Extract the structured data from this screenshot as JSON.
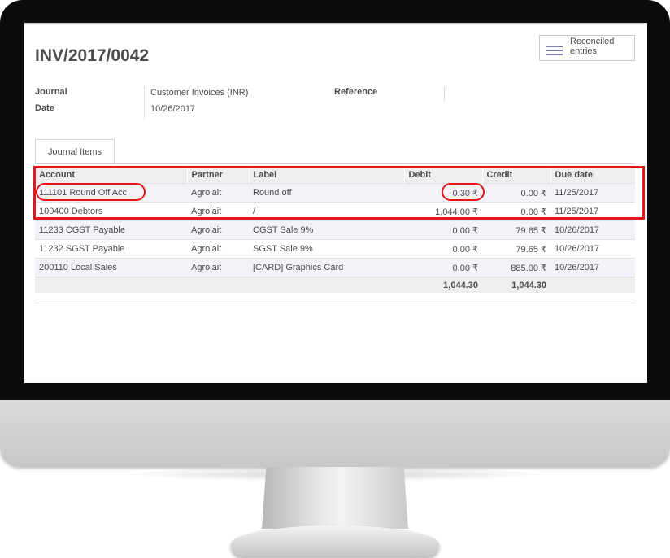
{
  "document": {
    "title": "INV/2017/0042",
    "reconciled_button": "Reconciled entries",
    "fields": {
      "journal_label": "Journal",
      "journal_value": "Customer Invoices (INR)",
      "date_label": "Date",
      "date_value": "10/26/2017",
      "reference_label": "Reference"
    }
  },
  "tabs": [
    {
      "label": "Journal Items"
    }
  ],
  "table": {
    "headers": [
      "Account",
      "Partner",
      "Label",
      "Debit",
      "Credit",
      "Due date"
    ],
    "rows": [
      {
        "account": "111101 Round Off Acc",
        "partner": "Agrolait",
        "label": "Round off",
        "debit": "0.30 ₹",
        "credit": "0.00 ₹",
        "due": "11/25/2017"
      },
      {
        "account": "100400 Debtors",
        "partner": "Agrolait",
        "label": "/",
        "debit": "1,044.00 ₹",
        "credit": "0.00 ₹",
        "due": "11/25/2017"
      },
      {
        "account": "11233 CGST Payable",
        "partner": "Agrolait",
        "label": "CGST Sale 9%",
        "debit": "0.00 ₹",
        "credit": "79.65 ₹",
        "due": "10/26/2017"
      },
      {
        "account": "11232 SGST Payable",
        "partner": "Agrolait",
        "label": "SGST Sale 9%",
        "debit": "0.00 ₹",
        "credit": "79.65 ₹",
        "due": "10/26/2017"
      },
      {
        "account": "200110 Local Sales",
        "partner": "Agrolait",
        "label": "[CARD] Graphics Card",
        "debit": "0.00 ₹",
        "credit": "885.00 ₹",
        "due": "10/26/2017"
      }
    ],
    "totals": {
      "debit": "1,044.30",
      "credit": "1,044.30"
    }
  },
  "colors": {
    "highlight": "#e8141b",
    "menu_icon": "#7c7bad",
    "text": "#4c4c4c"
  },
  "icons": [
    "hamburger-menu-icon"
  ]
}
